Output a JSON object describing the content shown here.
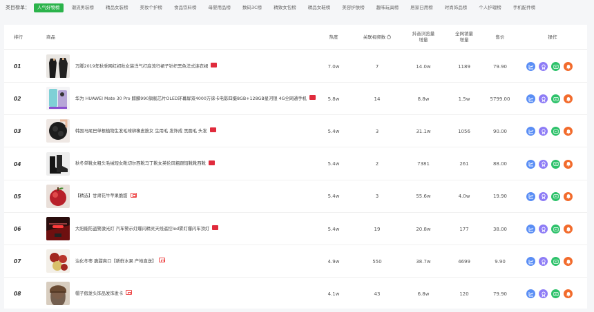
{
  "categories": {
    "title": "类目榜单：",
    "items": [
      {
        "label": "人气好物榜",
        "active": true
      },
      {
        "label": "潮流男装榜",
        "active": false
      },
      {
        "label": "精品女装榜",
        "active": false
      },
      {
        "label": "美妆个护榜",
        "active": false
      },
      {
        "label": "食品饮料榜",
        "active": false
      },
      {
        "label": "母婴用品榜",
        "active": false
      },
      {
        "label": "数码3C榜",
        "active": false
      },
      {
        "label": "精致女包榜",
        "active": false
      },
      {
        "label": "精品女鞋榜",
        "active": false
      },
      {
        "label": "美容护肤榜",
        "active": false
      },
      {
        "label": "趣味玩具榜",
        "active": false
      },
      {
        "label": "居家日用榜",
        "active": false
      },
      {
        "label": "时尚饰品榜",
        "active": false
      },
      {
        "label": "个人护理榜",
        "active": false
      },
      {
        "label": "手机配件榜",
        "active": false
      }
    ]
  },
  "table": {
    "headers": {
      "rank": "排行",
      "product": "商品",
      "heat": "热度",
      "videos": "关联视频数",
      "views_l1": "抖音浏览量",
      "views_l2": "增量",
      "sales_l1": "全网销量",
      "sales_l2": "增量",
      "price": "售价",
      "ops": "操作"
    },
    "rows": [
      {
        "rank": "01",
        "title": "万脚2019年秋季网红初秋女装洋气打底流行裙子针织黑色法式连衣裙",
        "tag": "red",
        "heat": "7.0w",
        "videos": "7",
        "views": "14.0w",
        "sales": "1189",
        "price": "79.90",
        "thumb": "dress"
      },
      {
        "rank": "02",
        "title": "华为 HUAWEI Mate 30 Pro 麒麟990旗舰芯片OLED环幕屏双4000万徕卡电影四摄8GB+128GB星河银 4G全网通手机",
        "tag": "red",
        "heat": "5.8w",
        "videos": "14",
        "views": "8.8w",
        "sales": "1.5w",
        "price": "5799.00",
        "thumb": "phone"
      },
      {
        "rank": "03",
        "title": "韩国马尾巴单根植物生发毛球绑橡皮筋女 生用毛 发饰成 黑圆毛 头发",
        "tag": "red",
        "heat": "5.4w",
        "videos": "3",
        "views": "31.1w",
        "sales": "1056",
        "price": "90.00",
        "thumb": "hair"
      },
      {
        "rank": "04",
        "title": "秋冬单靴女粗头毛绒短女靴切尔西靴马丁靴女英伦风粗跟短靴靴西靴",
        "tag": "red",
        "heat": "5.4w",
        "videos": "2",
        "views": "7381",
        "sales": "261",
        "price": "88.00",
        "thumb": "boots"
      },
      {
        "rank": "05",
        "title": "【精选】甘肃花牛苹果脆甜",
        "tag": "outline",
        "heat": "5.4w",
        "videos": "3",
        "views": "55.6w",
        "sales": "4.0w",
        "price": "19.90",
        "thumb": "apple"
      },
      {
        "rank": "06",
        "title": "大阳能防盗警激光灯 汽车警示灯爆闪精灵天线遥控led雾灯爆闪车顶灯",
        "tag": "red",
        "heat": "5.4w",
        "videos": "19",
        "views": "20.8w",
        "sales": "177",
        "price": "38.00",
        "thumb": "light"
      },
      {
        "rank": "07",
        "title": "沾化冬枣 脆甜爽口【新鲜水果 产地直送】",
        "tag": "outline",
        "heat": "4.9w",
        "videos": "550",
        "views": "38.7w",
        "sales": "4699",
        "price": "9.90",
        "thumb": "jujube"
      },
      {
        "rank": "08",
        "title": "帽子假发头饰品发饰发卡",
        "tag": "outline",
        "heat": "4.1w",
        "videos": "43",
        "views": "6.8w",
        "sales": "120",
        "price": "79.90",
        "thumb": "hat"
      }
    ]
  },
  "icons": {
    "op1": "chart-icon",
    "op2": "rank-icon",
    "op3": "video-icon",
    "op4": "alert-icon"
  },
  "colors": {
    "accent": "#2bb34b",
    "tag_red": "#e02b3c",
    "op_blue": "#5a8ef5",
    "op_purple": "#8e7cf6",
    "op_green": "#2ec26b",
    "op_orange": "#f26b2c"
  }
}
